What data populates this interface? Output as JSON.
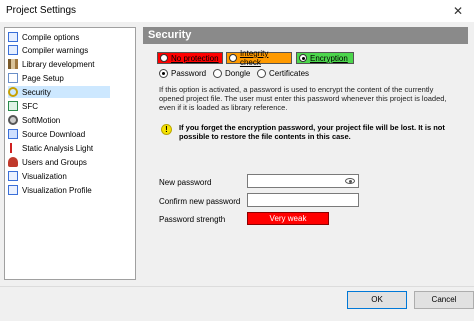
{
  "window": {
    "title": "Project Settings",
    "close_glyph": "✕"
  },
  "nav": {
    "items": [
      {
        "label": "Compile options",
        "icon": "checkbox-list-icon",
        "color": "#3a6fd8"
      },
      {
        "label": "Compiler warnings",
        "icon": "checkbox-list-icon",
        "color": "#3a6fd8"
      },
      {
        "label": "Library development",
        "icon": "library-icon",
        "color": "#7a5a2a"
      },
      {
        "label": "Page Setup",
        "icon": "page-setup-icon",
        "color": "#6a8fc8"
      },
      {
        "label": "Security",
        "icon": "security-icon",
        "color": "#c8a000",
        "selected": true
      },
      {
        "label": "SFC",
        "icon": "sfc-icon",
        "color": "#2a8a4a"
      },
      {
        "label": "SoftMotion",
        "icon": "softmotion-icon",
        "color": "#555555"
      },
      {
        "label": "Source Download",
        "icon": "source-download-icon",
        "color": "#3a6fd8"
      },
      {
        "label": "Static Analysis Light",
        "icon": "static-analysis-icon",
        "color": "#d02020"
      },
      {
        "label": "Users and Groups",
        "icon": "users-groups-icon",
        "color": "#c0392b"
      },
      {
        "label": "Visualization",
        "icon": "visualization-icon",
        "color": "#3a6fd8"
      },
      {
        "label": "Visualization Profile",
        "icon": "visualization-profile-icon",
        "color": "#3a6fd8"
      }
    ]
  },
  "section": {
    "title": "Security",
    "badges": [
      {
        "label": "No protection",
        "color": "#ff0000",
        "selected": false
      },
      {
        "label": "Integrity check",
        "color": "#ff9a00",
        "selected": false
      },
      {
        "label": "Encryption",
        "color": "#4cd64c",
        "selected": true
      }
    ],
    "radios": [
      {
        "label": "Password",
        "selected": true
      },
      {
        "label": "Dongle",
        "selected": false
      },
      {
        "label": "Certificates",
        "selected": false
      }
    ],
    "description": "If this option is activated, a password is used to encrypt the content of the currently opened project file. The user must enter this password whenever this project is loaded, even if it is loaded as library reference.",
    "warning": "If you forget the encryption password, your project file will be lost. It is not possible to restore the file contents in this case.",
    "fields": {
      "new_password_label": "New password",
      "confirm_password_label": "Confirm new password",
      "strength_label": "Password strength",
      "strength_value": "Very weak",
      "strength_color": "#ff0000"
    }
  },
  "buttons": {
    "ok": "OK",
    "cancel": "Cancel"
  }
}
